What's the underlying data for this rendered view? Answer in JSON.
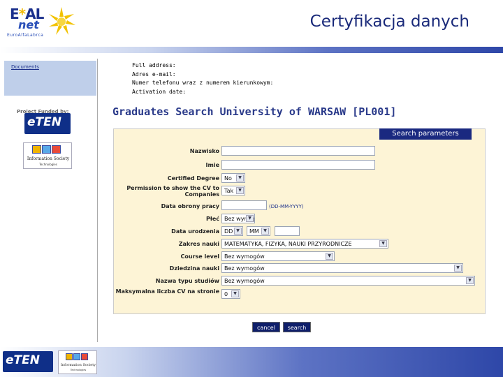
{
  "header": {
    "logo_main": "E",
    "logo_star": "*",
    "logo_main_rest": "AL",
    "logo_sub1": "net",
    "logo_sub2": "EuroAlfaLabrca",
    "title": "Certyfikacja danych"
  },
  "sidebar": {
    "nav_link": "Documents",
    "funded_label": "Project Funded by:",
    "eten_logo": "eTEN",
    "isoc_logo_text": "Information Society",
    "isoc_logo_sub": "Technologies"
  },
  "user_info": {
    "full_address_label": "Full address:",
    "email_label": "Adres e-mail:",
    "phone_label": "Numer telefonu wraz z numerem kierunkowym:",
    "activation_label": "Activation date:"
  },
  "results": {
    "heading": "Graduates Search University of WARSAW [PL001]",
    "panel_title": "Search parameters"
  },
  "form": {
    "nazwisko_label": "Nazwisko",
    "nazwisko_value": "",
    "imie_label": "Imie",
    "imie_value": "",
    "degree_label": "Certified Degree",
    "degree_value": "No",
    "permission_label": "Permission to show the CV to Companies",
    "permission_value": "Tak",
    "data_obrony_label": "Data obrony pracy",
    "data_obrony_value": "",
    "data_obrony_hint": "(DD-MM-YYYY)",
    "plec_label": "Płeć",
    "plec_value": "Bez wymogów",
    "data_urodzenia_label": "Data urodzenia",
    "day_value": "DD",
    "month_value": "MM",
    "year_value": "",
    "zakres_label": "Zakres nauki",
    "zakres_value": "MATEMATYKA, FIZYKA, NAUKI PRZYRODNICZE",
    "course_label": "Course level",
    "course_value": "Bez wymogów",
    "dziedzina_label": "Dziedzina nauki",
    "dziedzina_value": "Bez wymogów",
    "typ_label": "Nazwa typu studiów",
    "typ_value": "Bez wymogów",
    "max_cv_label": "Maksymalna liczba CV na stronie",
    "max_cv_value": "0",
    "cancel_label": "cancel",
    "search_label": "search"
  },
  "footer": {
    "eten_logo": "eTEN",
    "isoc_logo_text": "Information Society",
    "isoc_logo_sub": "Technologies"
  },
  "colors": {
    "panel_bg": "#fdf4d6",
    "panel_header": "#1a2980",
    "title_color": "#1a2a7a",
    "heading_color": "#2a3a8a"
  }
}
